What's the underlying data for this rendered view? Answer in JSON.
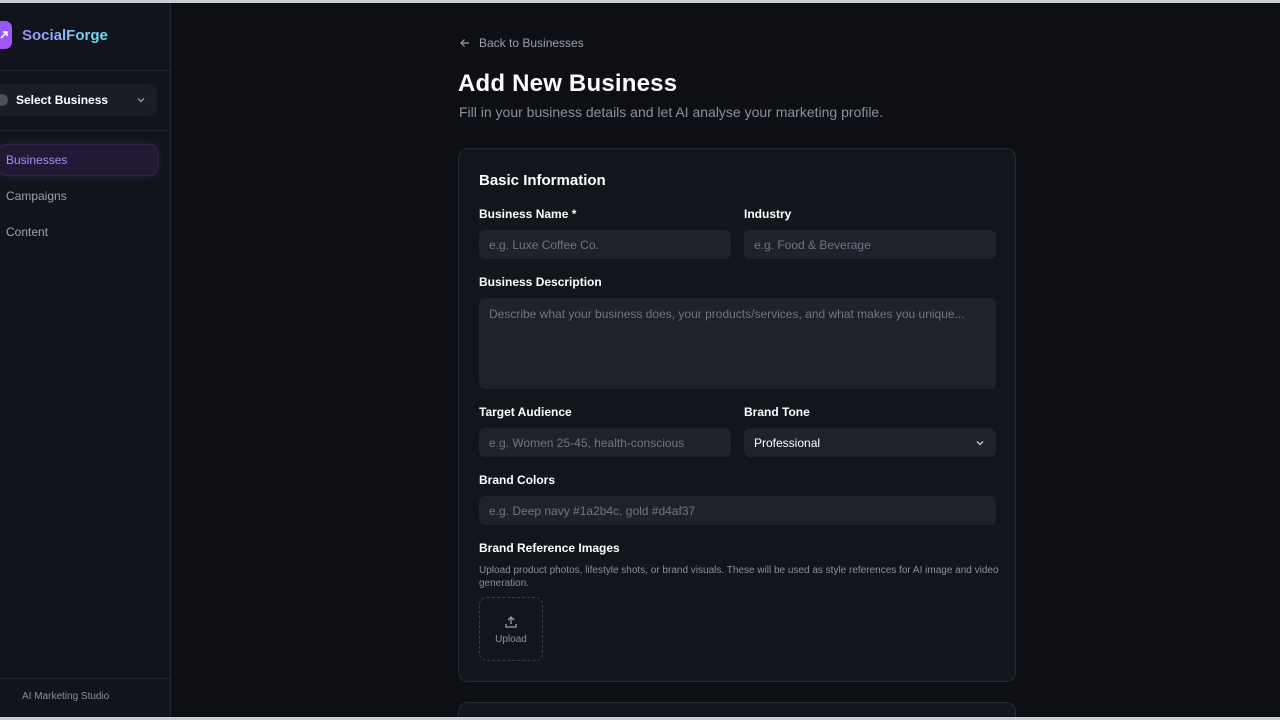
{
  "brand": {
    "name": "SocialForge"
  },
  "sidebar": {
    "business_select": "Select Business",
    "items": [
      {
        "label": "Businesses",
        "active": true
      },
      {
        "label": "Campaigns",
        "active": false
      },
      {
        "label": "Content",
        "active": false
      }
    ],
    "footer": "AI Marketing Studio"
  },
  "page": {
    "back_label": "Back to Businesses",
    "title": "Add New Business",
    "subtitle": "Fill in your business details and let AI analyse your marketing profile."
  },
  "form": {
    "section_title": "Basic Information",
    "business_name": {
      "label": "Business Name *",
      "placeholder": "e.g. Luxe Coffee Co.",
      "value": ""
    },
    "industry": {
      "label": "Industry",
      "placeholder": "e.g. Food & Beverage",
      "value": ""
    },
    "description": {
      "label": "Business Description",
      "placeholder": "Describe what your business does, your products/services, and what makes you unique...",
      "value": ""
    },
    "target_audience": {
      "label": "Target Audience",
      "placeholder": "e.g. Women 25-45, health-conscious",
      "value": ""
    },
    "brand_tone": {
      "label": "Brand Tone",
      "value": "Professional"
    },
    "brand_colors": {
      "label": "Brand Colors",
      "placeholder": "e.g. Deep navy #1a2b4c, gold #d4af37",
      "value": ""
    },
    "reference_images": {
      "label": "Brand Reference Images",
      "helper": "Upload product photos, lifestyle shots, or brand visuals. These will be used as style references for AI image and video generation.",
      "upload_label": "Upload"
    }
  },
  "colors": {
    "accent": "#8b5cf6",
    "background": "#0d0f14",
    "card": "#12151c",
    "input": "#1f222b"
  }
}
